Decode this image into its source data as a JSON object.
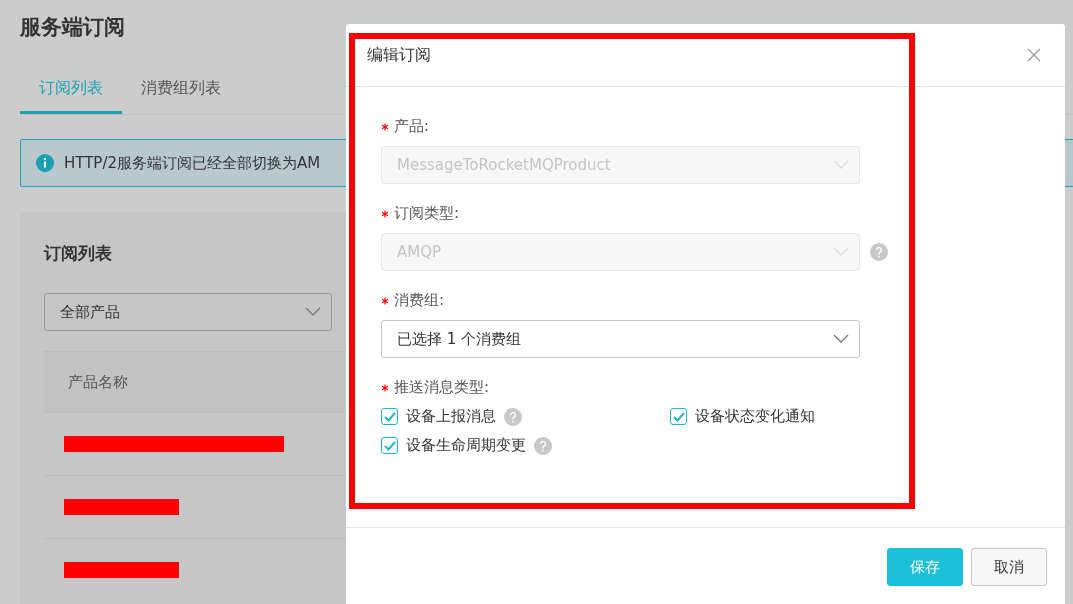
{
  "page": {
    "title": "服务端订阅",
    "tabs": [
      {
        "label": "订阅列表",
        "selected": true
      },
      {
        "label": "消费组列表",
        "selected": false
      }
    ],
    "notice": "HTTP/2服务端订阅已经全部切换为AM",
    "card": {
      "title": "订阅列表",
      "filter": "全部产品",
      "table": {
        "columns": [
          "产品名称"
        ],
        "rows": [
          {
            "redacted": true
          },
          {
            "redacted": true
          },
          {
            "redacted": true
          }
        ]
      }
    }
  },
  "dialog": {
    "title": "编辑订阅",
    "fields": [
      {
        "label": "产品:",
        "required": true,
        "value": "MessageToRocketMQProduct",
        "disabled": true,
        "help": false
      },
      {
        "label": "订阅类型:",
        "required": true,
        "value": "AMQP",
        "disabled": true,
        "help": true
      },
      {
        "label": "消费组:",
        "required": true,
        "value": "已选择 1 个消费组",
        "disabled": false,
        "help": false
      }
    ],
    "push_types": {
      "label": "推送消息类型:",
      "required": true,
      "options": [
        {
          "label": "设备上报消息",
          "checked": true,
          "help": true
        },
        {
          "label": "设备状态变化通知",
          "checked": true,
          "help": false
        },
        {
          "label": "设备生命周期变更",
          "checked": true,
          "help": true
        }
      ]
    },
    "buttons": [
      {
        "label": "保存",
        "kind": "primary"
      },
      {
        "label": "取消",
        "kind": "secondary"
      }
    ]
  }
}
